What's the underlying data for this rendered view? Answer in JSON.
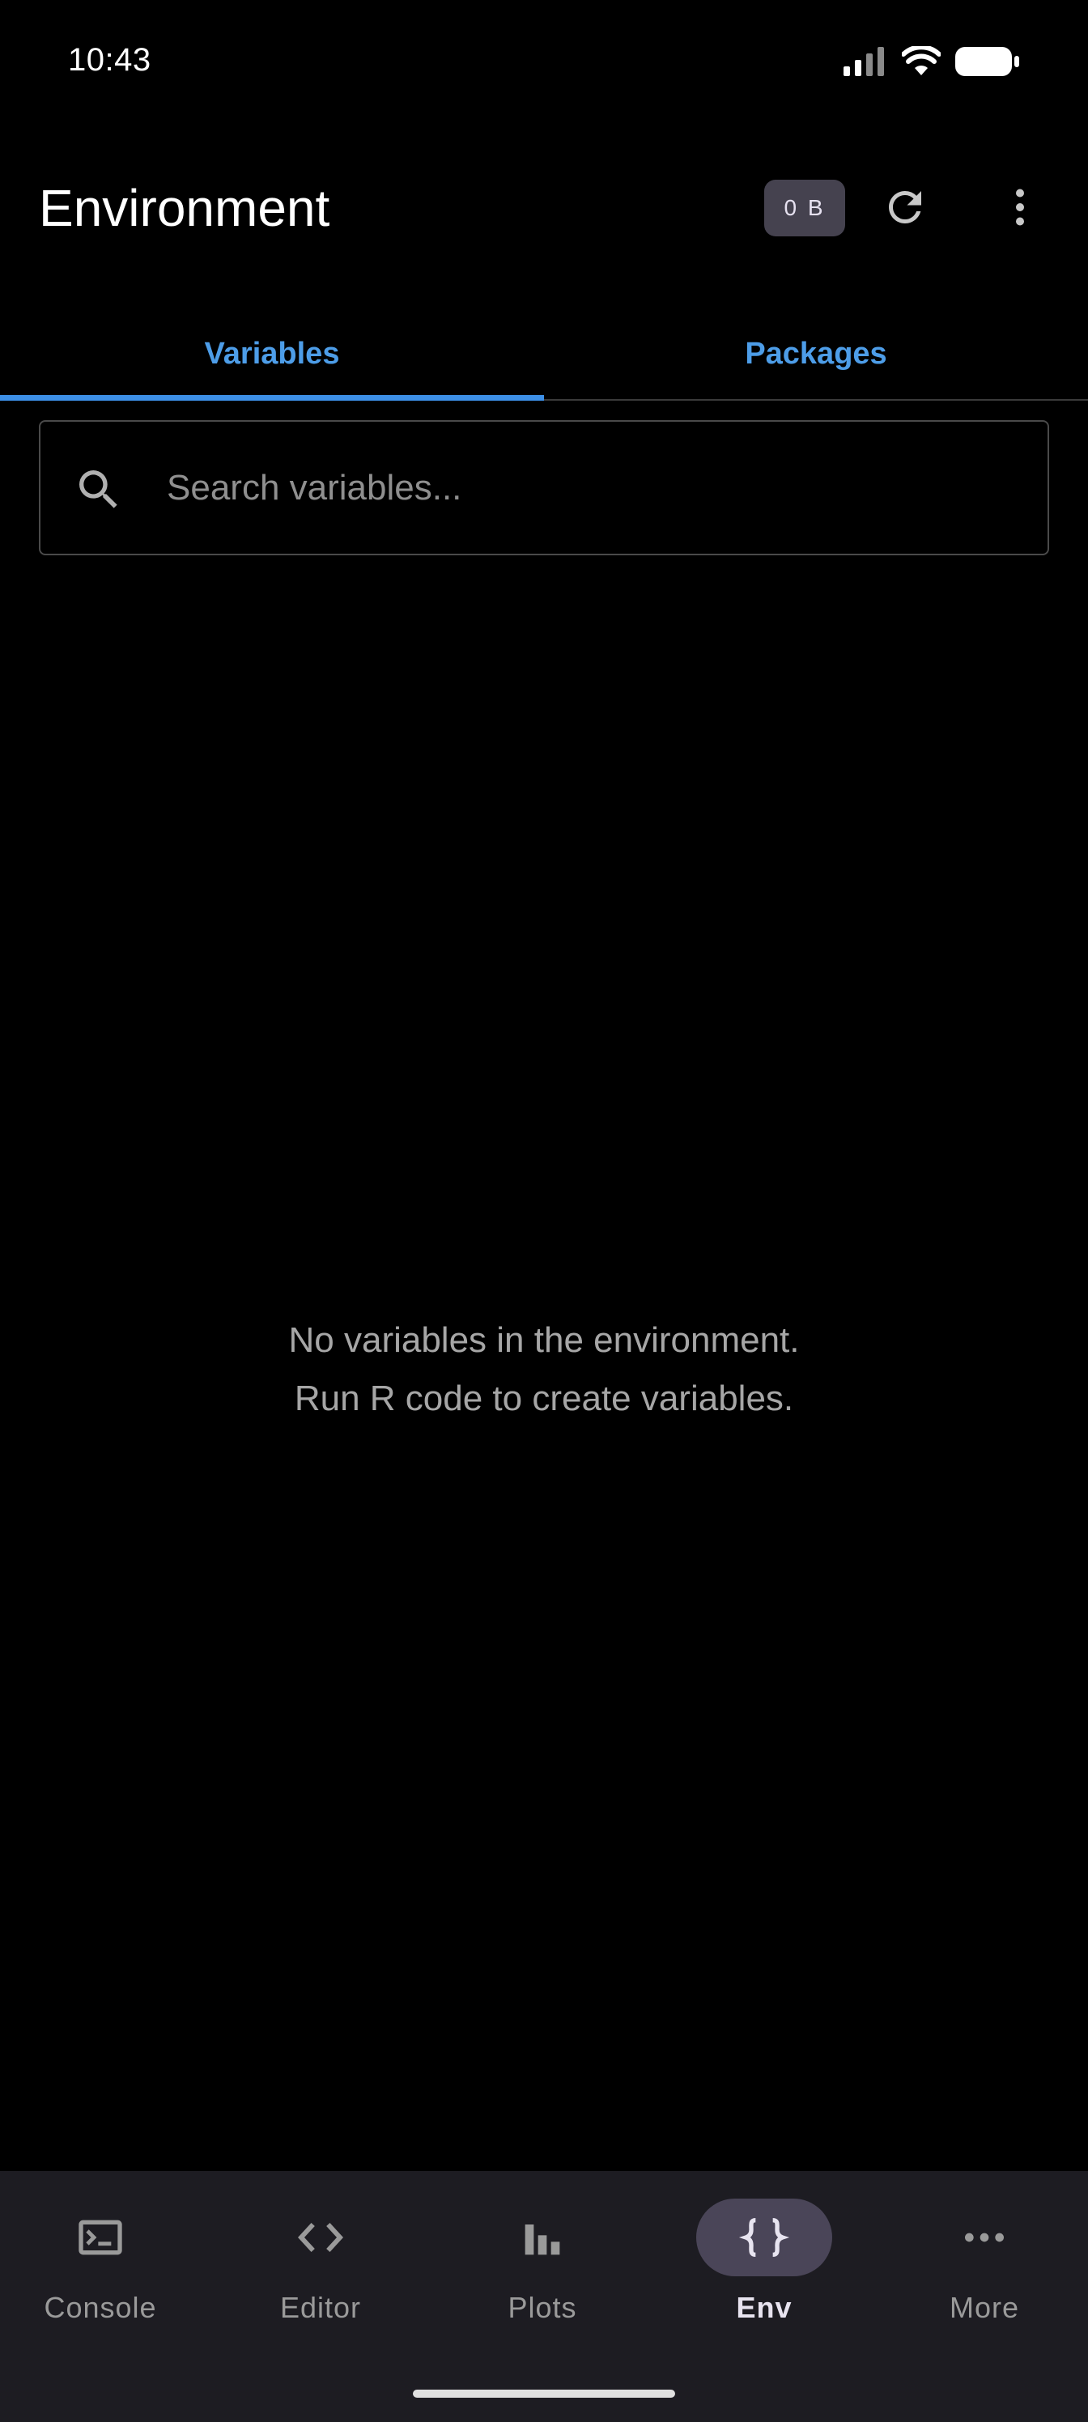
{
  "status_bar": {
    "time": "10:43"
  },
  "header": {
    "title": "Environment",
    "memory_badge": "0 B"
  },
  "tabs": [
    {
      "label": "Variables",
      "active": true
    },
    {
      "label": "Packages",
      "active": false
    }
  ],
  "search": {
    "value": "",
    "placeholder": "Search variables..."
  },
  "empty_state": {
    "line1": "No variables in the environment.",
    "line2": "Run R code to create variables."
  },
  "bottom_nav": {
    "items": [
      {
        "label": "Console",
        "icon": "terminal-icon",
        "active": false
      },
      {
        "label": "Editor",
        "icon": "code-icon",
        "active": false
      },
      {
        "label": "Plots",
        "icon": "bar-chart-icon",
        "active": false
      },
      {
        "label": "Env",
        "icon": "braces-icon",
        "active": true
      },
      {
        "label": "More",
        "icon": "more-horizontal-icon",
        "active": false
      }
    ]
  },
  "colors": {
    "accent": "#3d8fe6",
    "background": "#000000",
    "nav_background": "#1d1c22",
    "active_pill": "#4a4558",
    "badge_background": "#45424f"
  }
}
